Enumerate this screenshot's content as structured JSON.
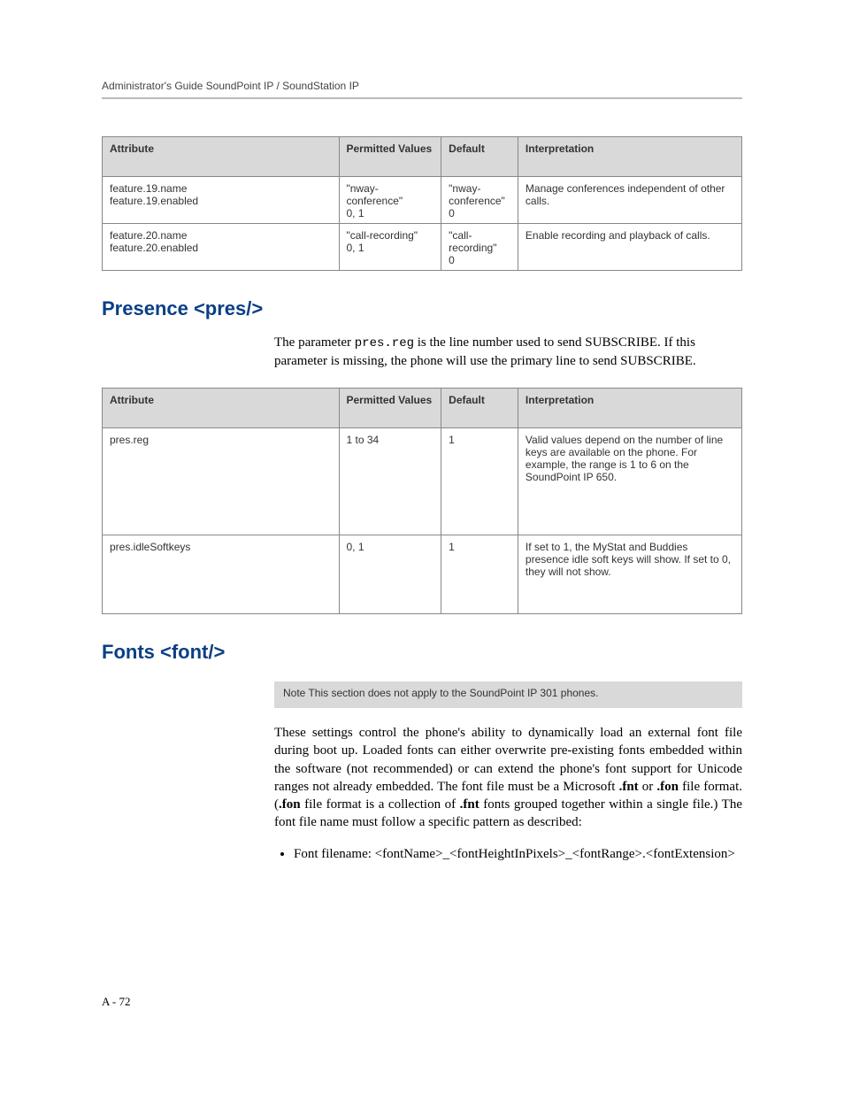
{
  "header": "Administrator's Guide SoundPoint IP / SoundStation IP",
  "table1": {
    "headers": [
      "Attribute",
      "Permitted Values",
      "Default",
      "Interpretation"
    ],
    "rows": [
      [
        "feature.19.name\nfeature.19.enabled",
        "\"nway-conference\"\n0, 1",
        "\"nway-conference\"\n0",
        "Manage conferences independent of other calls."
      ],
      [
        "feature.20.name\nfeature.20.enabled",
        "\"call-recording\"\n0, 1",
        "\"call-recording\"\n0",
        "Enable recording and playback of calls."
      ]
    ]
  },
  "section1": {
    "title": "Presence <pres/>",
    "para_pre": "The parameter ",
    "para_code": "pres.reg",
    "para_post": " is the line number used to send SUBSCRIBE. If this parameter is missing, the phone will use the primary line to send SUBSCRIBE."
  },
  "table2": {
    "headers": [
      "Attribute",
      "Permitted Values",
      "Default",
      "Interpretation"
    ],
    "rows": [
      [
        "pres.reg",
        "1 to 34",
        "1",
        "Valid values depend on the number of line keys are available on the phone. For example, the range is 1 to 6 on the SoundPoint IP 650."
      ],
      [
        "pres.idleSoftkeys",
        "0, 1",
        "1",
        "If set to 1, the MyStat and Buddies presence idle soft keys will show. If set to 0, they will not show."
      ]
    ]
  },
  "section2": {
    "title": "Fonts <font/>",
    "note": "Note    This section does not apply to the SoundPoint IP 301 phones.",
    "para": "These settings control the phone's ability to dynamically load an external font file during boot up. Loaded fonts can either overwrite pre-existing fonts embedded within the software (not recommended) or can extend the phone's font support for Unicode ranges not already embedded. The font file must be a Microsoft ",
    "b1": ".fnt",
    "mid1": " or ",
    "b2": ".fon",
    "mid2": " file format. (",
    "b3": ".fon",
    "mid3": " file format is a collection of ",
    "b4": ".fnt",
    "mid4": " fonts grouped together within a single file.) The font file name must follow a specific pattern as described:",
    "bullet": "Font filename: <fontName>_<fontHeightInPixels>_<fontRange>.<fontExtension>"
  },
  "footer": "A - 72"
}
